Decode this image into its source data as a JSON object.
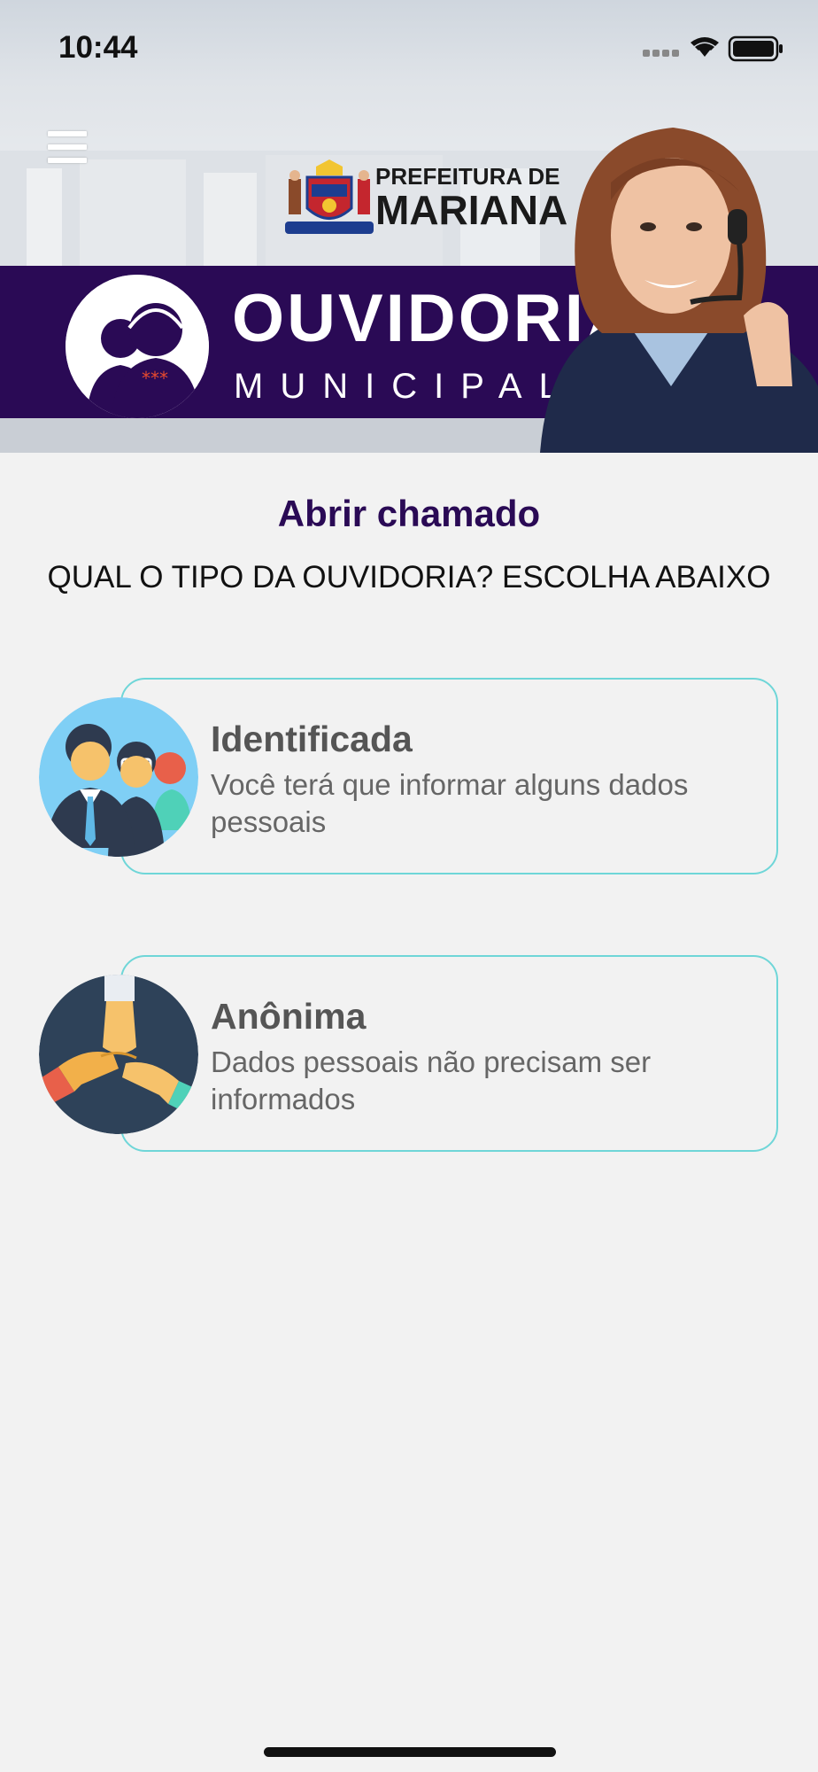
{
  "status_bar": {
    "time": "10:44"
  },
  "header": {
    "logo_line1": "PREFEITURA DE",
    "logo_line2": "MARIANA",
    "banner_title": "OUVIDORIA",
    "banner_subtitle": "MUNICIPAL"
  },
  "main": {
    "title": "Abrir chamado",
    "subtitle": "QUAL O TIPO DA OUVIDORIA? ESCOLHA ABAIXO",
    "options": [
      {
        "title": "Identificada",
        "description": "Você terá que informar alguns dados pessoais",
        "icon": "people-group-icon"
      },
      {
        "title": "Anônima",
        "description": "Dados pessoais não precisam ser informados",
        "icon": "joined-hands-icon"
      }
    ]
  },
  "colors": {
    "brand_purple": "#2a0a55",
    "card_border": "#6fd6d8",
    "background": "#f2f2f2"
  }
}
